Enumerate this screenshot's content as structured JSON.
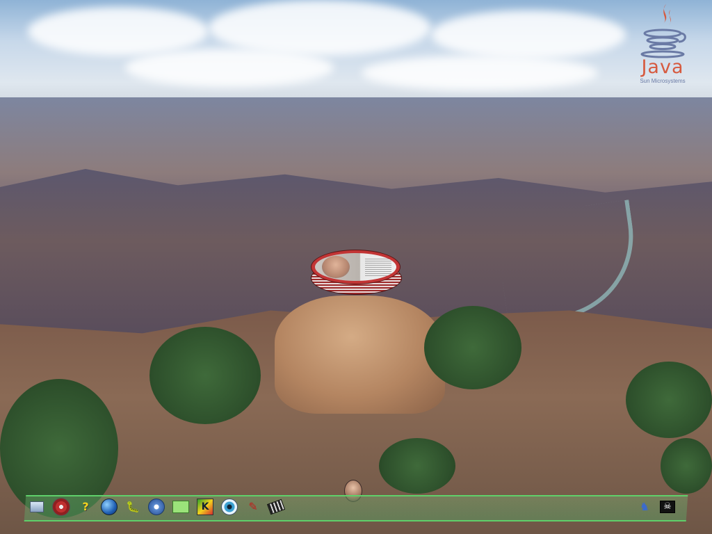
{
  "logo": {
    "name": "Java",
    "company": "Sun Microsystems",
    "colors": {
      "java_red": "#d65a3f",
      "java_blue": "#6a7aa5"
    }
  },
  "floating_window": {
    "type": "3d-disc-window",
    "border_color": "#c23535"
  },
  "taskbar": {
    "accent": "#5fd06a",
    "left_icons": [
      {
        "id": "monitor",
        "icon": "monitor-icon"
      },
      {
        "id": "cd",
        "icon": "cd-icon"
      },
      {
        "id": "help",
        "icon": "help-icon",
        "glyph": "?"
      },
      {
        "id": "globe",
        "icon": "globe-icon"
      },
      {
        "id": "bug",
        "icon": "bug-icon",
        "glyph": "🐛"
      },
      {
        "id": "network",
        "icon": "network-icon"
      },
      {
        "id": "folder",
        "icon": "folder-icon"
      },
      {
        "id": "k-menu",
        "icon": "k-menu-icon",
        "glyph": "K"
      },
      {
        "id": "eye",
        "icon": "eye-icon"
      },
      {
        "id": "pen",
        "icon": "pen-icon",
        "glyph": "✎"
      },
      {
        "id": "film",
        "icon": "film-icon"
      }
    ],
    "right_icons": [
      {
        "id": "robot",
        "icon": "robot-icon",
        "glyph": "♞"
      },
      {
        "id": "pirate",
        "icon": "pirate-icon",
        "glyph": "☠"
      }
    ]
  }
}
